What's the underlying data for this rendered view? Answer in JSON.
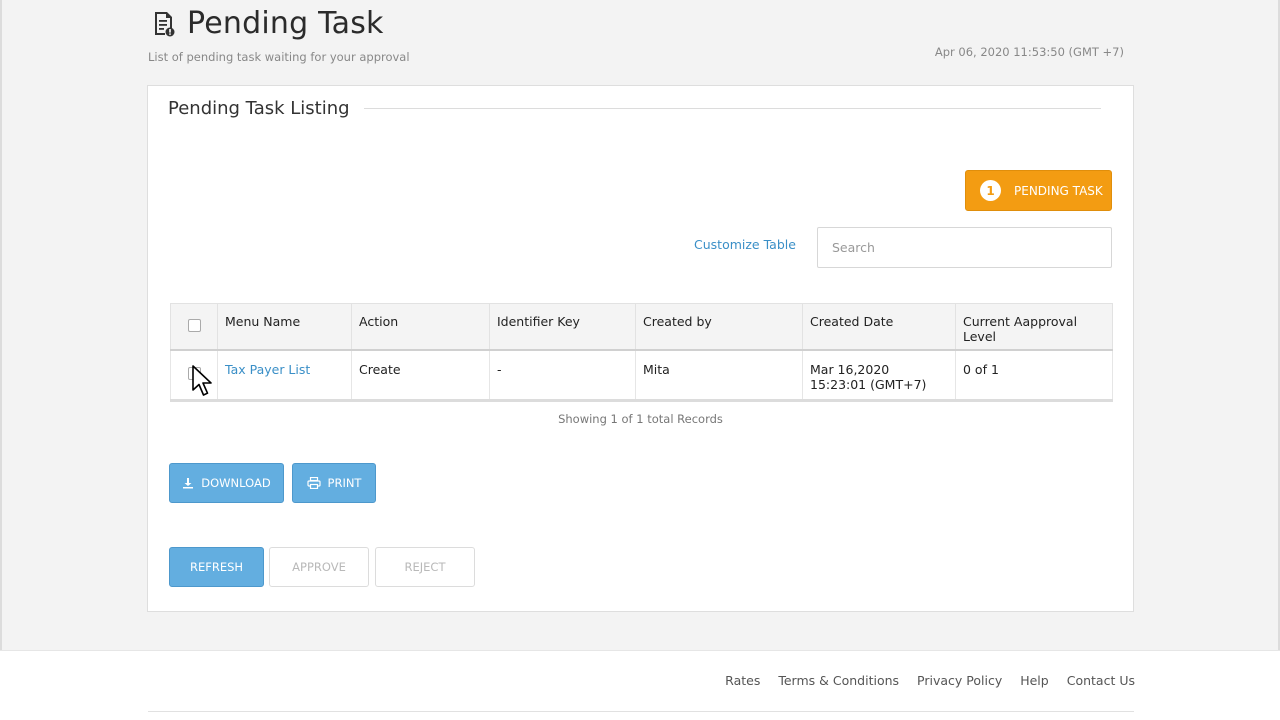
{
  "header": {
    "title": "Pending Task",
    "subtitle": "List of pending task waiting for your approval",
    "timestamp": "Apr 06, 2020 11:53:50 (GMT +7)"
  },
  "card": {
    "title": "Pending Task Listing",
    "pending_badge": {
      "count": "1",
      "label": "PENDING TASK",
      "color": "#f39c12"
    },
    "customize_label": "Customize Table",
    "search": {
      "placeholder": "Search",
      "value": ""
    }
  },
  "table": {
    "columns": [
      "Menu Name",
      "Action",
      "Identifier Key",
      "Created by",
      "Created Date",
      "Current Aapproval Level"
    ],
    "rows": [
      {
        "menu_name": "Tax Payer List",
        "action": "Create",
        "identifier_key": "-",
        "created_by": "Mita",
        "created_date": "Mar 16,2020 15:23:01 (GMT+7)",
        "approval_level": "0 of 1"
      }
    ],
    "records_info": "Showing 1 of 1 total Records"
  },
  "buttons": {
    "download": "DOWNLOAD",
    "print": "PRINT",
    "refresh": "REFRESH",
    "approve": "APPROVE",
    "reject": "REJECT"
  },
  "footer": {
    "links": [
      "Rates",
      "Terms & Conditions",
      "Privacy Policy",
      "Help",
      "Contact Us"
    ]
  },
  "colors": {
    "accent_blue": "#63aee0",
    "link_blue": "#3a8fc7",
    "badge_orange": "#f39c12"
  },
  "icons": {
    "title": "document-icon",
    "download": "download-icon",
    "print": "printer-icon",
    "cursor": "mouse-pointer-icon"
  }
}
